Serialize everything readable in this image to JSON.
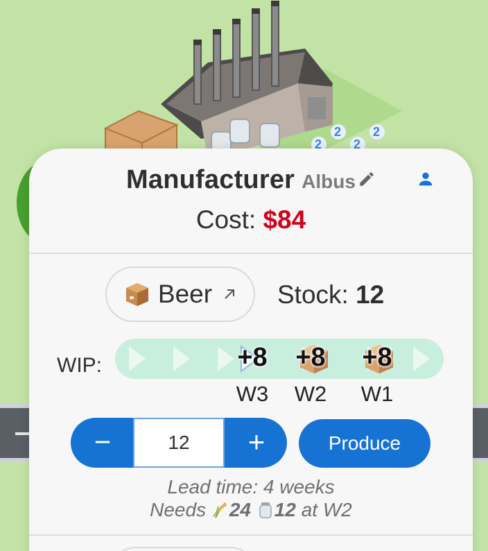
{
  "header": {
    "role_title": "Manufacturer",
    "player_name": "Albus",
    "cost_label": "Cost:",
    "cost_value": "$84"
  },
  "product": {
    "label": "Beer",
    "icon": "box-icon"
  },
  "stock": {
    "label": "Stock:",
    "value": "12"
  },
  "wip": {
    "label": "WIP:",
    "slots": [
      {
        "amount": "+8",
        "week": "W3"
      },
      {
        "amount": "+8",
        "week": "W2"
      },
      {
        "amount": "+8",
        "week": "W1"
      }
    ]
  },
  "production": {
    "decrement_label": "−",
    "quantity": "12",
    "increment_label": "+",
    "produce_label": "Produce",
    "lead_time": "Lead time: 4 weeks",
    "needs_prefix": "Needs",
    "needs_grain": "24",
    "needs_jar": "12",
    "needs_suffix": "at W2"
  },
  "colors": {
    "accent": "#1673d3",
    "cost": "#d0021b",
    "wip_track": "#c8eedd",
    "background": "#c3e3a6"
  }
}
